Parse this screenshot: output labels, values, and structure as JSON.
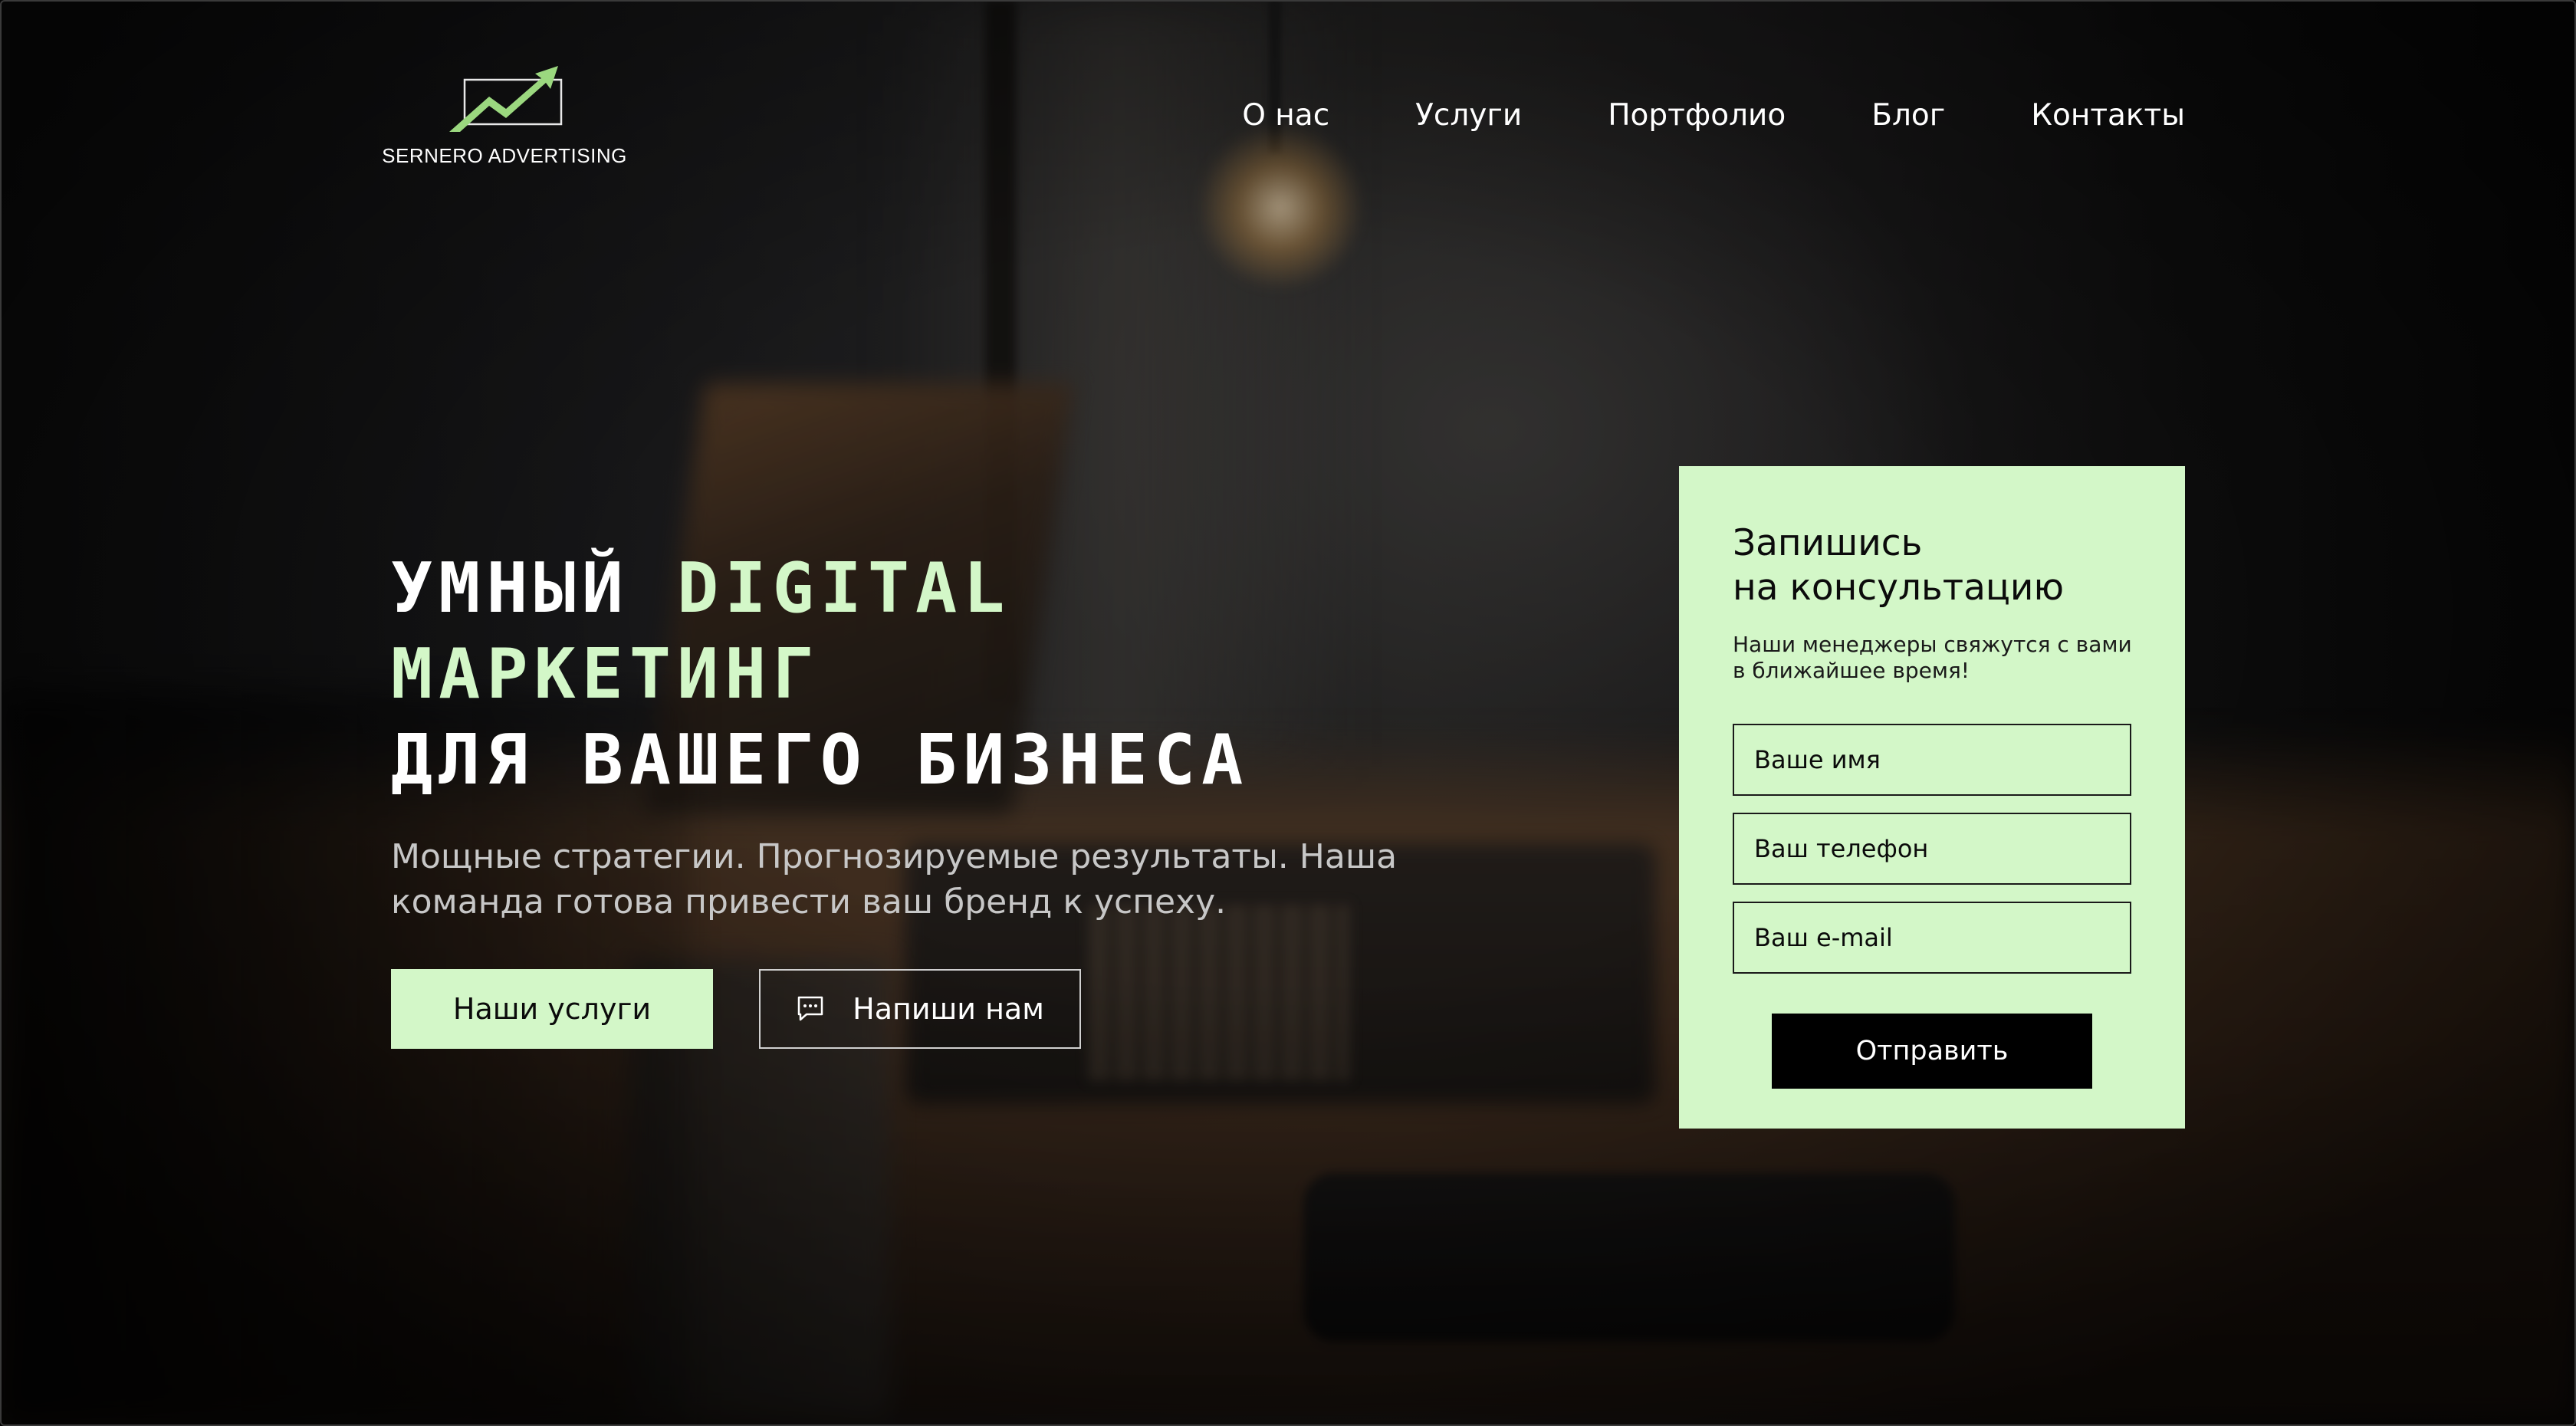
{
  "brand": {
    "name": "SERNERO ADVERTISING",
    "logo_icon": "trend-arrow-icon",
    "accent_color": "#d3f7c8",
    "logo_color": "#9bd87f"
  },
  "nav": {
    "items": [
      {
        "label": "О нас"
      },
      {
        "label": "Услуги"
      },
      {
        "label": "Портфолио"
      },
      {
        "label": "Блог"
      },
      {
        "label": "Контакты"
      }
    ]
  },
  "hero": {
    "title_line1_a": "Умный ",
    "title_line1_b": "Digital",
    "title_line2": "маркетинг",
    "title_line3": "для вашего бизнеса",
    "subtitle": "Мощные стратегии. Прогнозируемые результаты. Наша команда готова привести ваш бренд к успеху.",
    "primary_button": "Наши услуги",
    "secondary_button": "Напиши нам",
    "secondary_icon": "chat-bubble-icon"
  },
  "form": {
    "title_line1": "Запишись",
    "title_line2": "на консультацию",
    "subtitle_line1": "Наши менеджеры свяжутся с вами",
    "subtitle_line2": "в ближайшее время!",
    "name_placeholder": "Ваше имя",
    "phone_placeholder": "Ваш телефон",
    "email_placeholder": "Ваш e-mail",
    "submit_label": "Отправить",
    "background_color": "#d3f7c8"
  }
}
